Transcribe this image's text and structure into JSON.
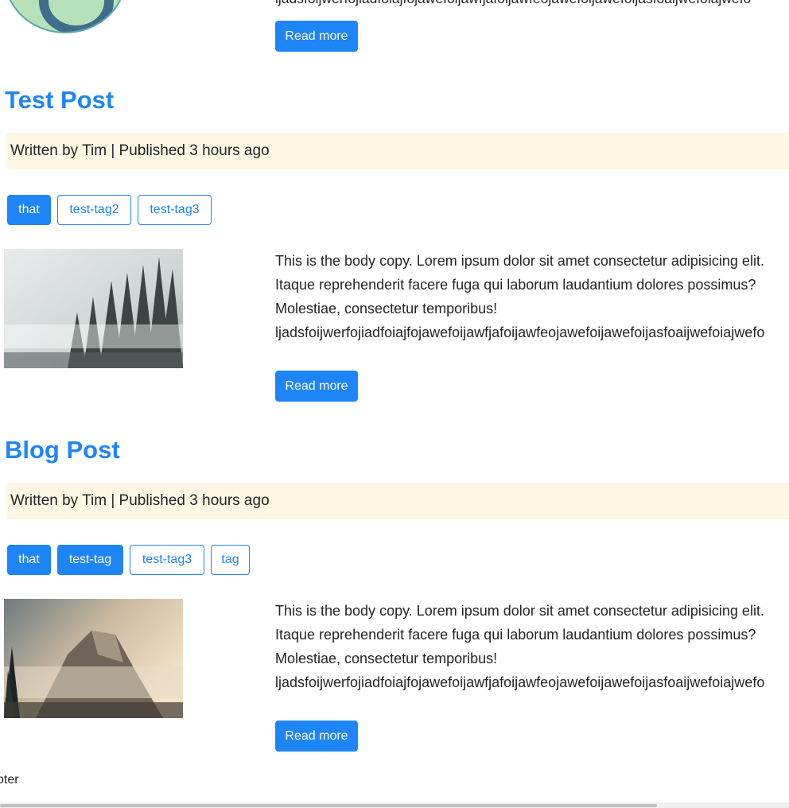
{
  "top_post": {
    "cut_body_text": "ljadsfoijwerfojiadfoiajfojawefoijawfjafoijawfeojawefoijawefoijasfoaijwefoiajwefo",
    "read_more": "Read more"
  },
  "posts": [
    {
      "title": "Test Post",
      "meta": "Written by Tim | Published 3 hours ago",
      "tags": [
        {
          "label": "that",
          "style": "filled"
        },
        {
          "label": "test-tag2",
          "style": "outline"
        },
        {
          "label": "test-tag3",
          "style": "outline"
        }
      ],
      "body_lines": [
        "This is the body copy. Lorem ipsum dolor sit amet consectetur adipisicing elit.",
        "Itaque reprehenderit facere fuga qui laborum laudantium dolores possimus?",
        "Molestiae, consectetur temporibus!",
        "ljadsfoijwerfojiadfoiajfojawefoijawfjafoijawfeojawefoijawefoijasfoaijwefoiajwefo"
      ],
      "read_more": "Read more"
    },
    {
      "title": "Blog Post",
      "meta": "Written by Tim | Published 3 hours ago",
      "tags": [
        {
          "label": "that",
          "style": "filled"
        },
        {
          "label": "test-tag",
          "style": "filled"
        },
        {
          "label": "test-tag3",
          "style": "outline"
        },
        {
          "label": "tag",
          "style": "outline"
        }
      ],
      "body_lines": [
        "This is the body copy. Lorem ipsum dolor sit amet consectetur adipisicing elit.",
        "Itaque reprehenderit facere fuga qui laborum laudantium dolores possimus?",
        "Molestiae, consectetur temporibus!",
        "ljadsfoijwerfojiadfoiajfojawefoijawfjafoijawfeojawefoijawefoijasfoaijwefoiajwefo"
      ],
      "read_more": "Read more"
    }
  ],
  "footer": {
    "text": "oter"
  },
  "colors": {
    "primary": "#1e85f6",
    "meta_bg": "#fdf7e3"
  }
}
